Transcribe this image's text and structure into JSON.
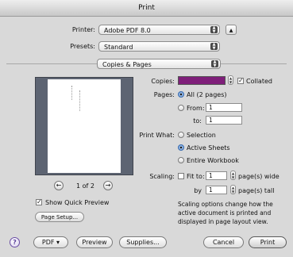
{
  "window": {
    "title": "Print"
  },
  "printer": {
    "label": "Printer:",
    "value": "Adobe PDF 8.0",
    "disclosure_icon": "triangle-up-icon"
  },
  "presets": {
    "label": "Presets:",
    "value": "Standard"
  },
  "panel": {
    "value": "Copies & Pages"
  },
  "preview": {
    "page_indicator": "1 of 2",
    "prev_icon": "left-arrow-icon",
    "next_icon": "right-arrow-icon",
    "show_quick_preview": "Show Quick Preview",
    "page_setup": "Page Setup..."
  },
  "copies": {
    "label": "Copies:",
    "collated": "Collated",
    "field_color": "#7f1f7a"
  },
  "pages": {
    "label": "Pages:",
    "all": "All  (2 pages)",
    "from_label": "From:",
    "from_value": "1",
    "to_label": "to:",
    "to_value": "1"
  },
  "print_what": {
    "label": "Print What:",
    "selection": "Selection",
    "active_sheets": "Active Sheets",
    "entire_workbook": "Entire Workbook"
  },
  "scaling": {
    "label": "Scaling:",
    "fit_to": "Fit to:",
    "wide_value": "1",
    "wide_unit": "page(s) wide",
    "by_label": "by",
    "tall_value": "1",
    "tall_unit": "page(s) tall",
    "note_line1": "Scaling options change how the",
    "note_line2": "active document is printed and",
    "note_line3": "displayed in page layout view."
  },
  "footer": {
    "help": "?",
    "pdf": "PDF ▾",
    "preview": "Preview",
    "supplies": "Supplies...",
    "cancel": "Cancel",
    "print": "Print"
  },
  "colors": {
    "accent": "#4d86cf",
    "preview_bg": "#5d6472"
  }
}
